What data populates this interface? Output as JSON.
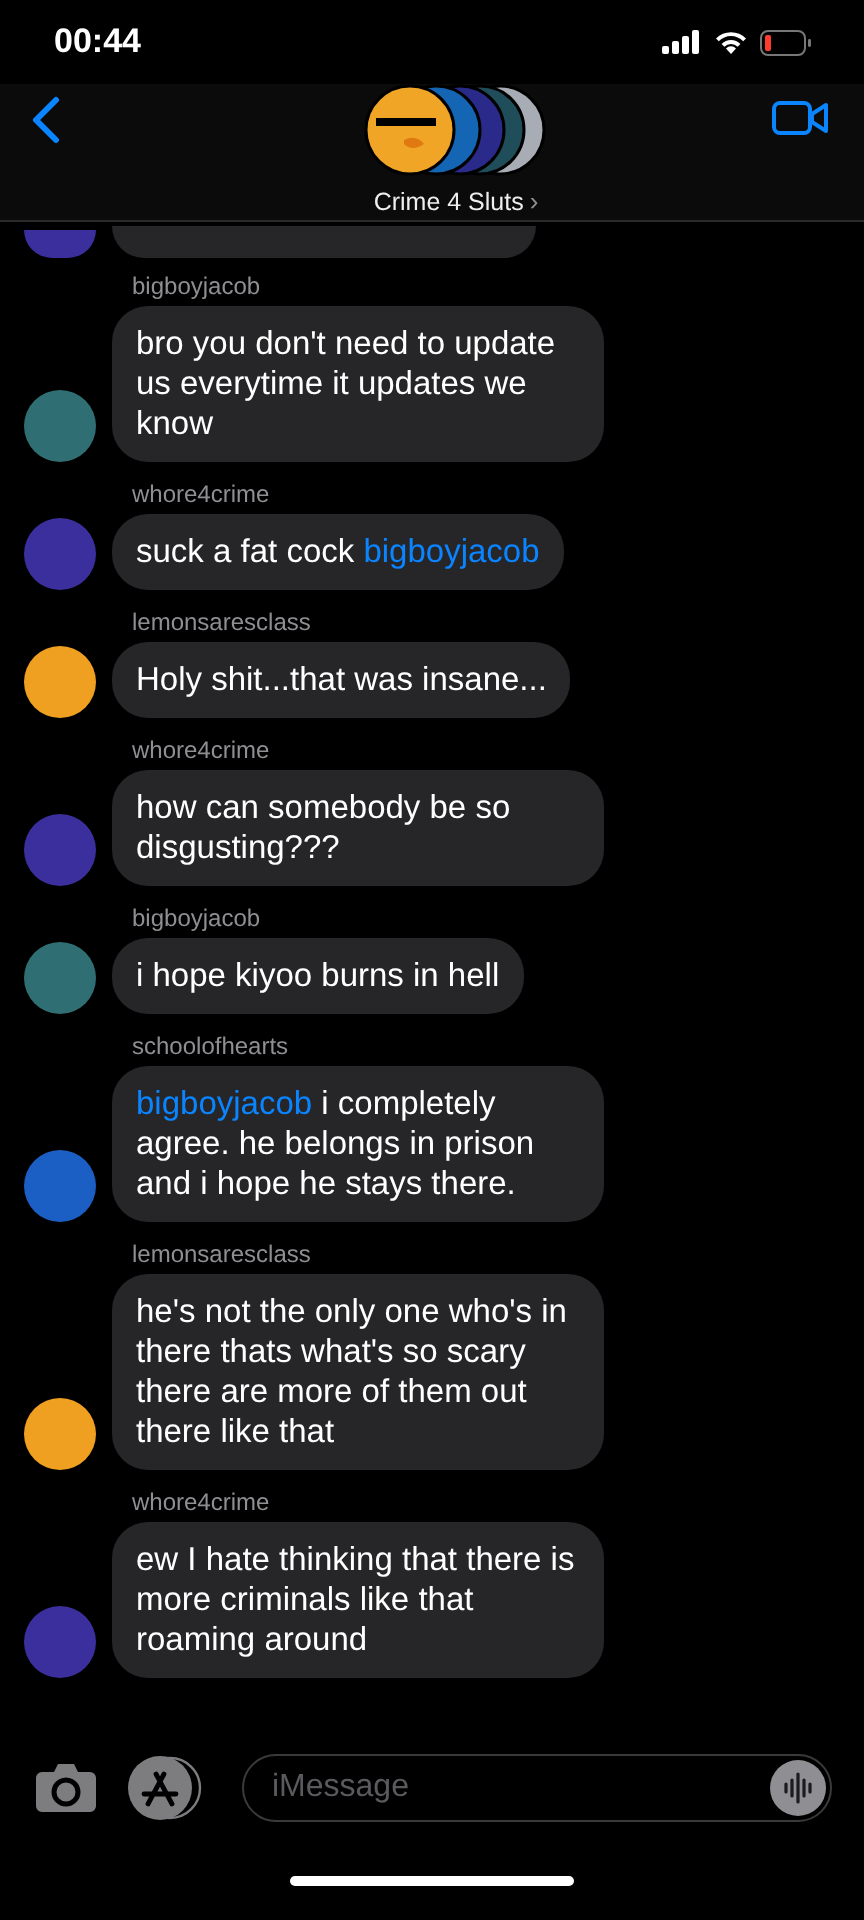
{
  "status_bar": {
    "time": "00:44"
  },
  "header": {
    "title": "Crime 4 Sluts",
    "chevron": "›"
  },
  "messages": [
    {
      "sender": "bigboyjacob",
      "color": "#2f6f73",
      "parts": [
        {
          "kind": "text",
          "text": "bro you don't need to update us everytime it updates we know"
        }
      ]
    },
    {
      "sender": "whore4crime",
      "color": "#3b2f9e",
      "parts": [
        {
          "kind": "text",
          "text": "suck a fat cock "
        },
        {
          "kind": "mention",
          "text": "bigboyjacob"
        }
      ]
    },
    {
      "sender": "lemonsaresclass",
      "color": "#f0a020",
      "parts": [
        {
          "kind": "text",
          "text": "Holy shit...that was insane..."
        }
      ]
    },
    {
      "sender": "whore4crime",
      "color": "#3b2f9e",
      "parts": [
        {
          "kind": "text",
          "text": "how can somebody be so disgusting???"
        }
      ]
    },
    {
      "sender": "bigboyjacob",
      "color": "#2f6f73",
      "parts": [
        {
          "kind": "text",
          "text": "i hope kiyoo burns in hell"
        }
      ]
    },
    {
      "sender": "schoolofhearts",
      "color": "#1b5fc4",
      "parts": [
        {
          "kind": "mention",
          "text": "bigboyjacob"
        },
        {
          "kind": "text",
          "text": " i completely agree. he belongs in prison and i hope he stays there."
        }
      ]
    },
    {
      "sender": "lemonsaresclass",
      "color": "#f0a020",
      "parts": [
        {
          "kind": "text",
          "text": "he's not the only one who's in there thats what's so scary there are more of them out there like that"
        }
      ]
    },
    {
      "sender": "whore4crime",
      "color": "#3b2f9e",
      "parts": [
        {
          "kind": "text",
          "text": "ew I hate thinking that there is more criminals like that roaming around"
        }
      ]
    }
  ],
  "composer": {
    "placeholder": "iMessage"
  }
}
